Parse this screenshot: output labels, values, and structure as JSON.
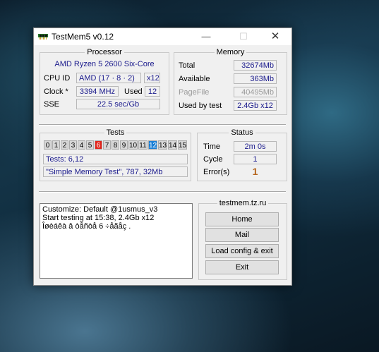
{
  "window": {
    "title": "TestMem5 v0.12"
  },
  "processor": {
    "label": "Processor",
    "name": "AMD Ryzen 5 2600 Six-Core",
    "cpuid_label": "CPU ID",
    "cpuid_value": "AMD  (17 · 8 · 2)",
    "threads": "x12",
    "clock_label": "Clock *",
    "clock_value": "3394 MHz",
    "used_label": "Used",
    "used_value": "12",
    "sse_label": "SSE",
    "sse_value": "22.5 sec/Gb"
  },
  "memory": {
    "label": "Memory",
    "total_label": "Total",
    "total_value": "32674Mb",
    "available_label": "Available",
    "available_value": "363Mb",
    "pagefile_label": "PageFile",
    "pagefile_value": "40495Mb",
    "usedby_label": "Used by test",
    "usedby_value": "2.4Gb x12"
  },
  "tests": {
    "label": "Tests",
    "numbers": [
      "0",
      "1",
      "2",
      "3",
      "4",
      "5",
      "6",
      "7",
      "8",
      "9",
      "10",
      "11",
      "12",
      "13",
      "14",
      "15"
    ],
    "error_index": 6,
    "current_index": 12,
    "summary": "Tests: 6,12",
    "current": "\"Simple Memory Test\", 787, 32Mb"
  },
  "status": {
    "label": "Status",
    "time_label": "Time",
    "time_value": "2m 0s",
    "cycle_label": "Cycle",
    "cycle_value": "1",
    "errors_label": "Error(s)",
    "errors_value": "1"
  },
  "log": {
    "lines": [
      "Customize: Default @1usmus_v3",
      "Start testing at 15:38, 2.4Gb x12",
      "Îøèáêà â òåñòå 6 ÷åãåç ."
    ]
  },
  "links": {
    "site": "testmem.tz.ru",
    "home": "Home",
    "mail": "Mail",
    "load": "Load config & exit",
    "exit": "Exit"
  },
  "colors": {
    "value_text": "#1a1a8c",
    "error_cell": "#e2231a",
    "current_cell": "#1a7fd6",
    "error_count": "#b5651d"
  }
}
